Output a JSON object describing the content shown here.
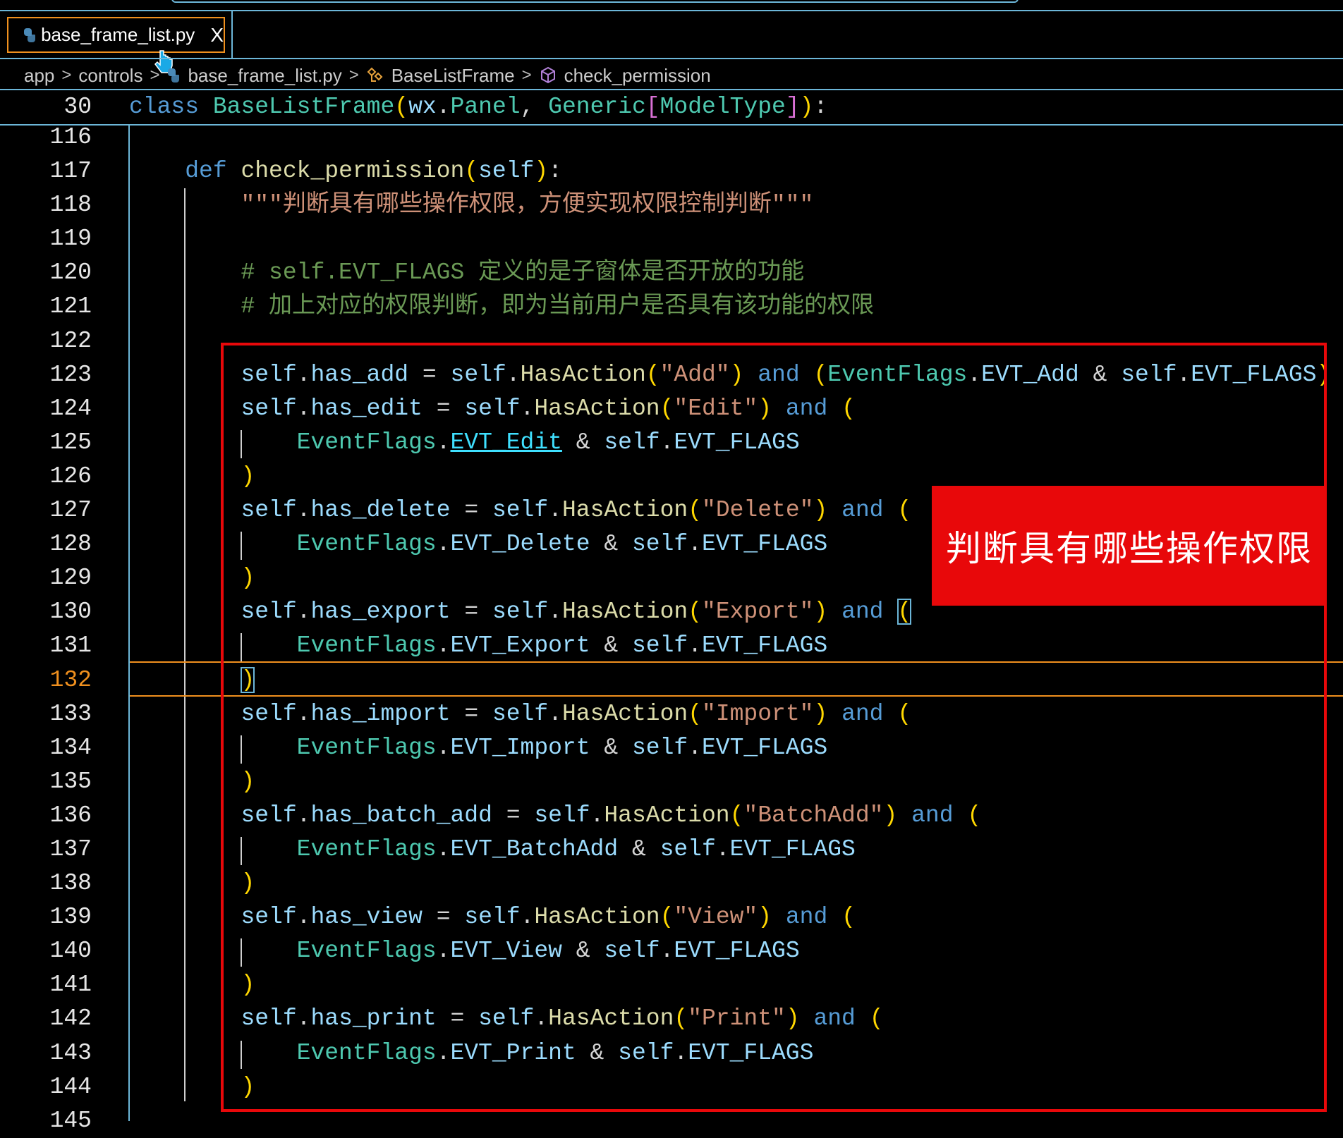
{
  "tab": {
    "label": "base_frame_list.py",
    "close": "X"
  },
  "breadcrumb": [
    "app",
    "controls",
    "base_frame_list.py",
    "BaseListFrame",
    "check_permission"
  ],
  "breadcrumb_sep": ">",
  "sticky": {
    "num": "30",
    "tokens": [
      [
        "k",
        "class"
      ],
      [
        "o",
        " "
      ],
      [
        "c",
        "BaseListFrame"
      ],
      [
        "b",
        "("
      ],
      [
        "v",
        "wx"
      ],
      [
        "o",
        "."
      ],
      [
        "c",
        "Panel"
      ],
      [
        "o",
        ", "
      ],
      [
        "c",
        "Generic"
      ],
      [
        "p",
        "["
      ],
      [
        "c",
        "ModelType"
      ],
      [
        "p",
        "]"
      ],
      [
        "b",
        ")"
      ],
      [
        "o",
        ":"
      ]
    ]
  },
  "annotation": "判断具有哪些操作权限",
  "current_line": 132,
  "lines": [
    {
      "num": "116",
      "tokens": []
    },
    {
      "num": "117",
      "tokens": [
        [
          "o",
          "    "
        ],
        [
          "k",
          "def"
        ],
        [
          "o",
          " "
        ],
        [
          "f",
          "check_permission"
        ],
        [
          "b",
          "("
        ],
        [
          "v",
          "self"
        ],
        [
          "b",
          ")"
        ],
        [
          "o",
          ":"
        ]
      ]
    },
    {
      "num": "118",
      "tokens": [
        [
          "o",
          "        "
        ],
        [
          "s",
          "\"\"\"判断具有哪些操作权限，方便实现权限控制判断\"\"\""
        ]
      ]
    },
    {
      "num": "119",
      "tokens": []
    },
    {
      "num": "120",
      "tokens": [
        [
          "o",
          "        "
        ],
        [
          "m",
          "# self.EVT_FLAGS 定义的是子窗体是否开放的功能"
        ]
      ]
    },
    {
      "num": "121",
      "tokens": [
        [
          "o",
          "        "
        ],
        [
          "m",
          "# 加上对应的权限判断，即为当前用户是否具有该功能的权限"
        ]
      ]
    },
    {
      "num": "122",
      "tokens": []
    },
    {
      "num": "123",
      "tokens": [
        [
          "o",
          "        "
        ],
        [
          "v",
          "self"
        ],
        [
          "o",
          "."
        ],
        [
          "v",
          "has_add"
        ],
        [
          "o",
          " = "
        ],
        [
          "v",
          "self"
        ],
        [
          "o",
          "."
        ],
        [
          "f",
          "HasAction"
        ],
        [
          "b",
          "("
        ],
        [
          "s",
          "\"Add\""
        ],
        [
          "b",
          ")"
        ],
        [
          "o",
          " "
        ],
        [
          "k",
          "and"
        ],
        [
          "o",
          " "
        ],
        [
          "b",
          "("
        ],
        [
          "c",
          "EventFlags"
        ],
        [
          "o",
          "."
        ],
        [
          "v",
          "EVT_Add"
        ],
        [
          "o",
          " & "
        ],
        [
          "v",
          "self"
        ],
        [
          "o",
          "."
        ],
        [
          "v",
          "EVT_FLAGS"
        ],
        [
          "b",
          ")"
        ]
      ]
    },
    {
      "num": "124",
      "tokens": [
        [
          "o",
          "        "
        ],
        [
          "v",
          "self"
        ],
        [
          "o",
          "."
        ],
        [
          "v",
          "has_edit"
        ],
        [
          "o",
          " = "
        ],
        [
          "v",
          "self"
        ],
        [
          "o",
          "."
        ],
        [
          "f",
          "HasAction"
        ],
        [
          "b",
          "("
        ],
        [
          "s",
          "\"Edit\""
        ],
        [
          "b",
          ")"
        ],
        [
          "o",
          " "
        ],
        [
          "k",
          "and"
        ],
        [
          "o",
          " "
        ],
        [
          "b",
          "("
        ]
      ]
    },
    {
      "num": "125",
      "cont": true,
      "tokens": [
        [
          "o",
          "            "
        ],
        [
          "c",
          "EventFlags"
        ],
        [
          "o",
          "."
        ],
        [
          "u",
          "EVT_Edit"
        ],
        [
          "o",
          " & "
        ],
        [
          "v",
          "self"
        ],
        [
          "o",
          "."
        ],
        [
          "v",
          "EVT_FLAGS"
        ]
      ]
    },
    {
      "num": "126",
      "tokens": [
        [
          "o",
          "        "
        ],
        [
          "b",
          ")"
        ]
      ]
    },
    {
      "num": "127",
      "tokens": [
        [
          "o",
          "        "
        ],
        [
          "v",
          "self"
        ],
        [
          "o",
          "."
        ],
        [
          "v",
          "has_delete"
        ],
        [
          "o",
          " = "
        ],
        [
          "v",
          "self"
        ],
        [
          "o",
          "."
        ],
        [
          "f",
          "HasAction"
        ],
        [
          "b",
          "("
        ],
        [
          "s",
          "\"Delete\""
        ],
        [
          "b",
          ")"
        ],
        [
          "o",
          " "
        ],
        [
          "k",
          "and"
        ],
        [
          "o",
          " "
        ],
        [
          "b",
          "("
        ]
      ]
    },
    {
      "num": "128",
      "cont": true,
      "tokens": [
        [
          "o",
          "            "
        ],
        [
          "c",
          "EventFlags"
        ],
        [
          "o",
          "."
        ],
        [
          "v",
          "EVT_Delete"
        ],
        [
          "o",
          " & "
        ],
        [
          "v",
          "self"
        ],
        [
          "o",
          "."
        ],
        [
          "v",
          "EVT_FLAGS"
        ]
      ]
    },
    {
      "num": "129",
      "tokens": [
        [
          "o",
          "        "
        ],
        [
          "b",
          ")"
        ]
      ]
    },
    {
      "num": "130",
      "tokens": [
        [
          "o",
          "        "
        ],
        [
          "v",
          "self"
        ],
        [
          "o",
          "."
        ],
        [
          "v",
          "has_export"
        ],
        [
          "o",
          " = "
        ],
        [
          "v",
          "self"
        ],
        [
          "o",
          "."
        ],
        [
          "f",
          "HasAction"
        ],
        [
          "b",
          "("
        ],
        [
          "s",
          "\"Export\""
        ],
        [
          "b",
          ")"
        ],
        [
          "o",
          " "
        ],
        [
          "k",
          "and"
        ],
        [
          "o",
          " "
        ],
        [
          "bx",
          "("
        ]
      ]
    },
    {
      "num": "131",
      "cont": true,
      "tokens": [
        [
          "o",
          "            "
        ],
        [
          "c",
          "EventFlags"
        ],
        [
          "o",
          "."
        ],
        [
          "v",
          "EVT_Export"
        ],
        [
          "o",
          " & "
        ],
        [
          "v",
          "self"
        ],
        [
          "o",
          "."
        ],
        [
          "v",
          "EVT_FLAGS"
        ]
      ]
    },
    {
      "num": "132",
      "tokens": [
        [
          "o",
          "        "
        ],
        [
          "bx",
          ")"
        ]
      ]
    },
    {
      "num": "133",
      "tokens": [
        [
          "o",
          "        "
        ],
        [
          "v",
          "self"
        ],
        [
          "o",
          "."
        ],
        [
          "v",
          "has_import"
        ],
        [
          "o",
          " = "
        ],
        [
          "v",
          "self"
        ],
        [
          "o",
          "."
        ],
        [
          "f",
          "HasAction"
        ],
        [
          "b",
          "("
        ],
        [
          "s",
          "\"Import\""
        ],
        [
          "b",
          ")"
        ],
        [
          "o",
          " "
        ],
        [
          "k",
          "and"
        ],
        [
          "o",
          " "
        ],
        [
          "b",
          "("
        ]
      ]
    },
    {
      "num": "134",
      "cont": true,
      "tokens": [
        [
          "o",
          "            "
        ],
        [
          "c",
          "EventFlags"
        ],
        [
          "o",
          "."
        ],
        [
          "v",
          "EVT_Import"
        ],
        [
          "o",
          " & "
        ],
        [
          "v",
          "self"
        ],
        [
          "o",
          "."
        ],
        [
          "v",
          "EVT_FLAGS"
        ]
      ]
    },
    {
      "num": "135",
      "tokens": [
        [
          "o",
          "        "
        ],
        [
          "b",
          ")"
        ]
      ]
    },
    {
      "num": "136",
      "tokens": [
        [
          "o",
          "        "
        ],
        [
          "v",
          "self"
        ],
        [
          "o",
          "."
        ],
        [
          "v",
          "has_batch_add"
        ],
        [
          "o",
          " = "
        ],
        [
          "v",
          "self"
        ],
        [
          "o",
          "."
        ],
        [
          "f",
          "HasAction"
        ],
        [
          "b",
          "("
        ],
        [
          "s",
          "\"BatchAdd\""
        ],
        [
          "b",
          ")"
        ],
        [
          "o",
          " "
        ],
        [
          "k",
          "and"
        ],
        [
          "o",
          " "
        ],
        [
          "b",
          "("
        ]
      ]
    },
    {
      "num": "137",
      "cont": true,
      "tokens": [
        [
          "o",
          "            "
        ],
        [
          "c",
          "EventFlags"
        ],
        [
          "o",
          "."
        ],
        [
          "v",
          "EVT_BatchAdd"
        ],
        [
          "o",
          " & "
        ],
        [
          "v",
          "self"
        ],
        [
          "o",
          "."
        ],
        [
          "v",
          "EVT_FLAGS"
        ]
      ]
    },
    {
      "num": "138",
      "tokens": [
        [
          "o",
          "        "
        ],
        [
          "b",
          ")"
        ]
      ]
    },
    {
      "num": "139",
      "tokens": [
        [
          "o",
          "        "
        ],
        [
          "v",
          "self"
        ],
        [
          "o",
          "."
        ],
        [
          "v",
          "has_view"
        ],
        [
          "o",
          " = "
        ],
        [
          "v",
          "self"
        ],
        [
          "o",
          "."
        ],
        [
          "f",
          "HasAction"
        ],
        [
          "b",
          "("
        ],
        [
          "s",
          "\"View\""
        ],
        [
          "b",
          ")"
        ],
        [
          "o",
          " "
        ],
        [
          "k",
          "and"
        ],
        [
          "o",
          " "
        ],
        [
          "b",
          "("
        ]
      ]
    },
    {
      "num": "140",
      "cont": true,
      "tokens": [
        [
          "o",
          "            "
        ],
        [
          "c",
          "EventFlags"
        ],
        [
          "o",
          "."
        ],
        [
          "v",
          "EVT_View"
        ],
        [
          "o",
          " & "
        ],
        [
          "v",
          "self"
        ],
        [
          "o",
          "."
        ],
        [
          "v",
          "EVT_FLAGS"
        ]
      ]
    },
    {
      "num": "141",
      "tokens": [
        [
          "o",
          "        "
        ],
        [
          "b",
          ")"
        ]
      ]
    },
    {
      "num": "142",
      "tokens": [
        [
          "o",
          "        "
        ],
        [
          "v",
          "self"
        ],
        [
          "o",
          "."
        ],
        [
          "v",
          "has_print"
        ],
        [
          "o",
          " = "
        ],
        [
          "v",
          "self"
        ],
        [
          "o",
          "."
        ],
        [
          "f",
          "HasAction"
        ],
        [
          "b",
          "("
        ],
        [
          "s",
          "\"Print\""
        ],
        [
          "b",
          ")"
        ],
        [
          "o",
          " "
        ],
        [
          "k",
          "and"
        ],
        [
          "o",
          " "
        ],
        [
          "b",
          "("
        ]
      ]
    },
    {
      "num": "143",
      "cont": true,
      "tokens": [
        [
          "o",
          "            "
        ],
        [
          "c",
          "EventFlags"
        ],
        [
          "o",
          "."
        ],
        [
          "v",
          "EVT_Print"
        ],
        [
          "o",
          " & "
        ],
        [
          "v",
          "self"
        ],
        [
          "o",
          "."
        ],
        [
          "v",
          "EVT_FLAGS"
        ]
      ]
    },
    {
      "num": "144",
      "tokens": [
        [
          "o",
          "        "
        ],
        [
          "b",
          ")"
        ]
      ]
    },
    {
      "num": "145",
      "tokens": []
    }
  ]
}
